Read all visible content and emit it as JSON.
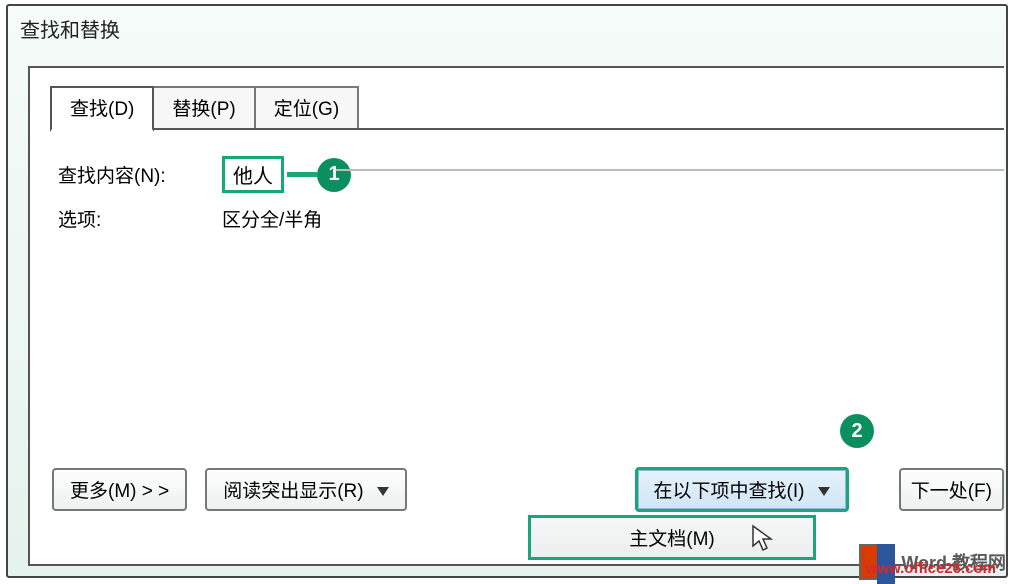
{
  "window": {
    "title": "查找和替换"
  },
  "tabs": {
    "find": "查找(D)",
    "replace": "替换(P)",
    "goto": "定位(G)"
  },
  "form": {
    "find_label": "查找内容(N):",
    "find_value": "他人",
    "options_label": "选项:",
    "options_value": "区分全/半角"
  },
  "buttons": {
    "more": "更多(M) > >",
    "reading_highlight": "阅读突出显示(R)",
    "find_in": "在以下项中查找(I)",
    "find_next": "下一处(F)"
  },
  "menu": {
    "main_document": "主文档(M)"
  },
  "callouts": {
    "one": "1",
    "two": "2"
  },
  "watermark": {
    "line1": "Word 教程网",
    "line2": "www.office26.com"
  }
}
